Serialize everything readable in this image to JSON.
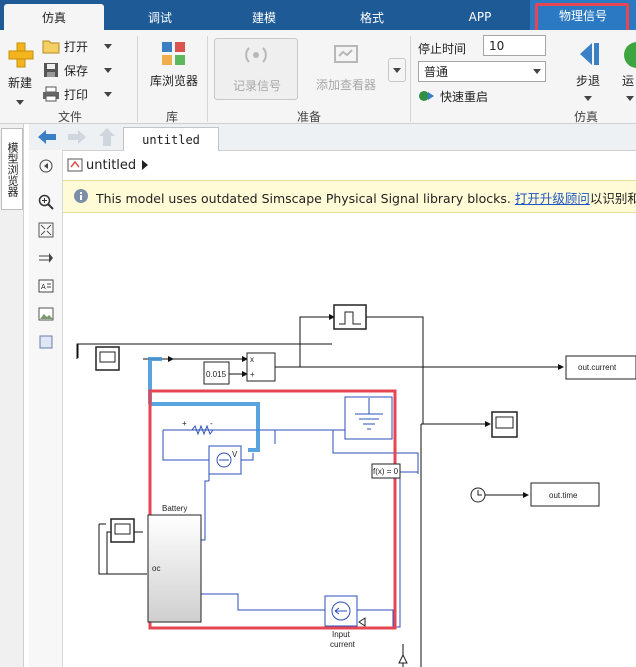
{
  "tabs": [
    {
      "label": "仿真",
      "active": true
    },
    {
      "label": "调试"
    },
    {
      "label": "建模"
    },
    {
      "label": "格式"
    },
    {
      "label": "APP"
    },
    {
      "label": "物理信号",
      "highlighted": true
    }
  ],
  "ribbon": {
    "file": {
      "new_label": "新建",
      "open_label": "打开",
      "save_label": "保存",
      "print_label": "打印",
      "group_label": "文件"
    },
    "library": {
      "browser_label": "库浏览器",
      "group_label": "库"
    },
    "prepare": {
      "log_signal_label": "记录信号",
      "add_viewer_label": "添加查看器",
      "group_label": "准备"
    },
    "simulate": {
      "stop_time_label": "停止时间",
      "stop_time_value": "10",
      "mode_value": "普通",
      "fast_restart_label": "快速重启",
      "step_back_label": "步退",
      "run_label": "运",
      "group_label": "仿真"
    }
  },
  "sidebar": {
    "browser_tab_label": "模型浏览器"
  },
  "nav": {
    "doc_tab": "untitled",
    "breadcrumb": "untitled"
  },
  "banner": {
    "message": "This model uses outdated Simscape Physical Signal library blocks.",
    "link_text": "打开升级顾问",
    "suffix": "以识别和修复"
  },
  "diagram": {
    "constant_value": "0.015",
    "product_in1": "x",
    "product_in2": "+",
    "out_current_label": "out.current",
    "out_time_label": "out.time",
    "battery_label": "Battery",
    "battery_port": "oc",
    "fcn_label": "f(x) = 0",
    "input_current_line1": "Input",
    "input_current_line2": "current",
    "sensor_v": "V",
    "resistor_minus": "-",
    "resistor_plus": "+"
  },
  "colors": {
    "tabbar_bg": "#1d5a96",
    "highlight_red": "#e64553",
    "physical_line": "#2b4fb8",
    "selected_line": "#3d93d9",
    "banner_bg": "#fffbd6"
  }
}
